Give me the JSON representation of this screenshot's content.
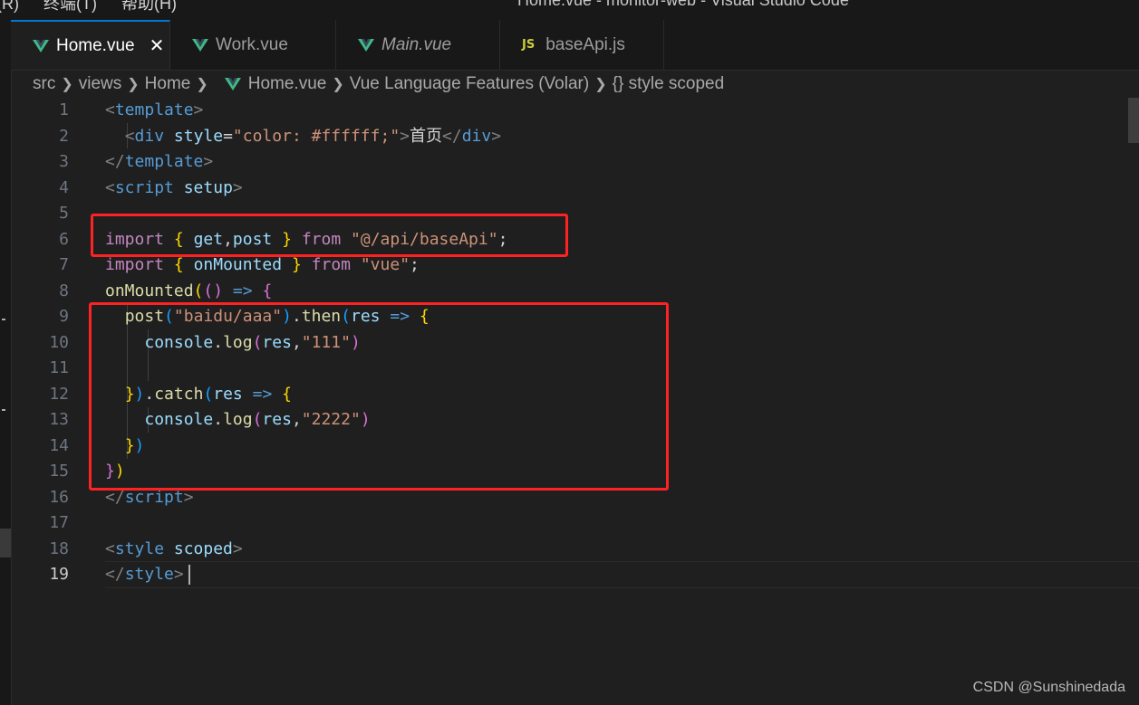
{
  "titlebar": {
    "menu_items": [
      "(R)",
      "终端(T)",
      "帮助(H)"
    ],
    "window_title": "Home.vue - monitor-web - Visual Studio Code"
  },
  "tabs": [
    {
      "label": "Home.vue",
      "icon": "vue-icon",
      "active": true,
      "close": "✕"
    },
    {
      "label": "Work.vue",
      "icon": "vue-icon",
      "active": false
    },
    {
      "label": "Main.vue",
      "icon": "vue-icon",
      "active": false,
      "italic": true
    },
    {
      "label": "baseApi.js",
      "icon": "js-icon",
      "icon_text": "JS",
      "active": false
    }
  ],
  "breadcrumb": {
    "items": [
      "src",
      "views",
      "Home",
      "Home.vue",
      "Vue Language Features (Volar)",
      "{} style scoped"
    ]
  },
  "editor": {
    "current_line": 19,
    "lines": [
      {
        "n": "1",
        "tokens": [
          [
            "t-tag",
            "<"
          ],
          [
            "t-name",
            "template"
          ],
          [
            "t-tag",
            ">"
          ]
        ]
      },
      {
        "n": "2",
        "tokens": [
          [
            "t-plain",
            "  "
          ],
          [
            "t-tag",
            "<"
          ],
          [
            "t-name",
            "div"
          ],
          [
            "t-plain",
            " "
          ],
          [
            "t-attr",
            "style"
          ],
          [
            "t-plain",
            "="
          ],
          [
            "t-str",
            "\"color: #ffffff;\""
          ],
          [
            "t-tag",
            ">"
          ],
          [
            "t-zh",
            "首页"
          ],
          [
            "t-tag",
            "</"
          ],
          [
            "t-name",
            "div"
          ],
          [
            "t-tag",
            ">"
          ]
        ]
      },
      {
        "n": "3",
        "tokens": [
          [
            "t-tag",
            "</"
          ],
          [
            "t-name",
            "template"
          ],
          [
            "t-tag",
            ">"
          ]
        ]
      },
      {
        "n": "4",
        "tokens": [
          [
            "t-tag",
            "<"
          ],
          [
            "t-name",
            "script"
          ],
          [
            "t-plain",
            " "
          ],
          [
            "t-attr",
            "setup"
          ],
          [
            "t-tag",
            ">"
          ]
        ]
      },
      {
        "n": "5",
        "tokens": []
      },
      {
        "n": "6",
        "tokens": [
          [
            "t-kw",
            "import"
          ],
          [
            "t-plain",
            " "
          ],
          [
            "t-b1",
            "{"
          ],
          [
            "t-plain",
            " "
          ],
          [
            "t-var",
            "get"
          ],
          [
            "t-plain",
            ","
          ],
          [
            "t-var",
            "post"
          ],
          [
            "t-plain",
            " "
          ],
          [
            "t-b1",
            "}"
          ],
          [
            "t-plain",
            " "
          ],
          [
            "t-kw",
            "from"
          ],
          [
            "t-plain",
            " "
          ],
          [
            "t-str",
            "\"@/api/baseApi\""
          ],
          [
            "t-plain",
            ";"
          ]
        ]
      },
      {
        "n": "7",
        "tokens": [
          [
            "t-kw",
            "import"
          ],
          [
            "t-plain",
            " "
          ],
          [
            "t-b1",
            "{"
          ],
          [
            "t-plain",
            " "
          ],
          [
            "t-var",
            "onMounted"
          ],
          [
            "t-plain",
            " "
          ],
          [
            "t-b1",
            "}"
          ],
          [
            "t-plain",
            " "
          ],
          [
            "t-kw",
            "from"
          ],
          [
            "t-plain",
            " "
          ],
          [
            "t-str",
            "\"vue\""
          ],
          [
            "t-plain",
            ";"
          ]
        ]
      },
      {
        "n": "8",
        "tokens": [
          [
            "t-fn",
            "onMounted"
          ],
          [
            "t-b1",
            "("
          ],
          [
            "t-b2",
            "()"
          ],
          [
            "t-plain",
            " "
          ],
          [
            "t-arrow",
            "=>"
          ],
          [
            "t-plain",
            " "
          ],
          [
            "t-b2",
            "{"
          ]
        ]
      },
      {
        "n": "9",
        "tokens": [
          [
            "t-plain",
            "  "
          ],
          [
            "t-fn",
            "post"
          ],
          [
            "t-b3",
            "("
          ],
          [
            "t-str",
            "\"baidu/aaa\""
          ],
          [
            "t-b3",
            ")"
          ],
          [
            "t-plain",
            "."
          ],
          [
            "t-fn",
            "then"
          ],
          [
            "t-b3",
            "("
          ],
          [
            "t-var",
            "res"
          ],
          [
            "t-plain",
            " "
          ],
          [
            "t-arrow",
            "=>"
          ],
          [
            "t-plain",
            " "
          ],
          [
            "t-b1",
            "{"
          ]
        ]
      },
      {
        "n": "10",
        "tokens": [
          [
            "t-plain",
            "    "
          ],
          [
            "t-var",
            "console"
          ],
          [
            "t-plain",
            "."
          ],
          [
            "t-fn",
            "log"
          ],
          [
            "t-b2",
            "("
          ],
          [
            "t-var",
            "res"
          ],
          [
            "t-plain",
            ","
          ],
          [
            "t-str",
            "\"111\""
          ],
          [
            "t-b2",
            ")"
          ]
        ]
      },
      {
        "n": "11",
        "tokens": []
      },
      {
        "n": "12",
        "tokens": [
          [
            "t-plain",
            "  "
          ],
          [
            "t-b1",
            "}"
          ],
          [
            "t-b3",
            ")"
          ],
          [
            "t-plain",
            "."
          ],
          [
            "t-fn",
            "catch"
          ],
          [
            "t-b3",
            "("
          ],
          [
            "t-var",
            "res"
          ],
          [
            "t-plain",
            " "
          ],
          [
            "t-arrow",
            "=>"
          ],
          [
            "t-plain",
            " "
          ],
          [
            "t-b1",
            "{"
          ]
        ]
      },
      {
        "n": "13",
        "tokens": [
          [
            "t-plain",
            "    "
          ],
          [
            "t-var",
            "console"
          ],
          [
            "t-plain",
            "."
          ],
          [
            "t-fn",
            "log"
          ],
          [
            "t-b2",
            "("
          ],
          [
            "t-var",
            "res"
          ],
          [
            "t-plain",
            ","
          ],
          [
            "t-str",
            "\"2222\""
          ],
          [
            "t-b2",
            ")"
          ]
        ]
      },
      {
        "n": "14",
        "tokens": [
          [
            "t-plain",
            "  "
          ],
          [
            "t-b1",
            "}"
          ],
          [
            "t-b3",
            ")"
          ]
        ]
      },
      {
        "n": "15",
        "tokens": [
          [
            "t-b2",
            "}"
          ],
          [
            "t-b1",
            ")"
          ]
        ]
      },
      {
        "n": "16",
        "tokens": [
          [
            "t-tag",
            "</"
          ],
          [
            "t-name",
            "script"
          ],
          [
            "t-tag",
            ">"
          ]
        ]
      },
      {
        "n": "17",
        "tokens": []
      },
      {
        "n": "18",
        "tokens": [
          [
            "t-tag",
            "<"
          ],
          [
            "t-name",
            "style"
          ],
          [
            "t-plain",
            " "
          ],
          [
            "t-attr",
            "scoped"
          ],
          [
            "t-tag",
            ">"
          ]
        ]
      },
      {
        "n": "19",
        "tokens": [
          [
            "t-tag",
            "</"
          ],
          [
            "t-name",
            "style"
          ],
          [
            "t-tag",
            ">"
          ]
        ]
      }
    ]
  },
  "watermark": "CSDN @Sunshinedada",
  "colors": {
    "annotation_box": "#ff2222",
    "active_tab_accent": "#0078d4",
    "editor_bg": "#1f1f1f"
  }
}
